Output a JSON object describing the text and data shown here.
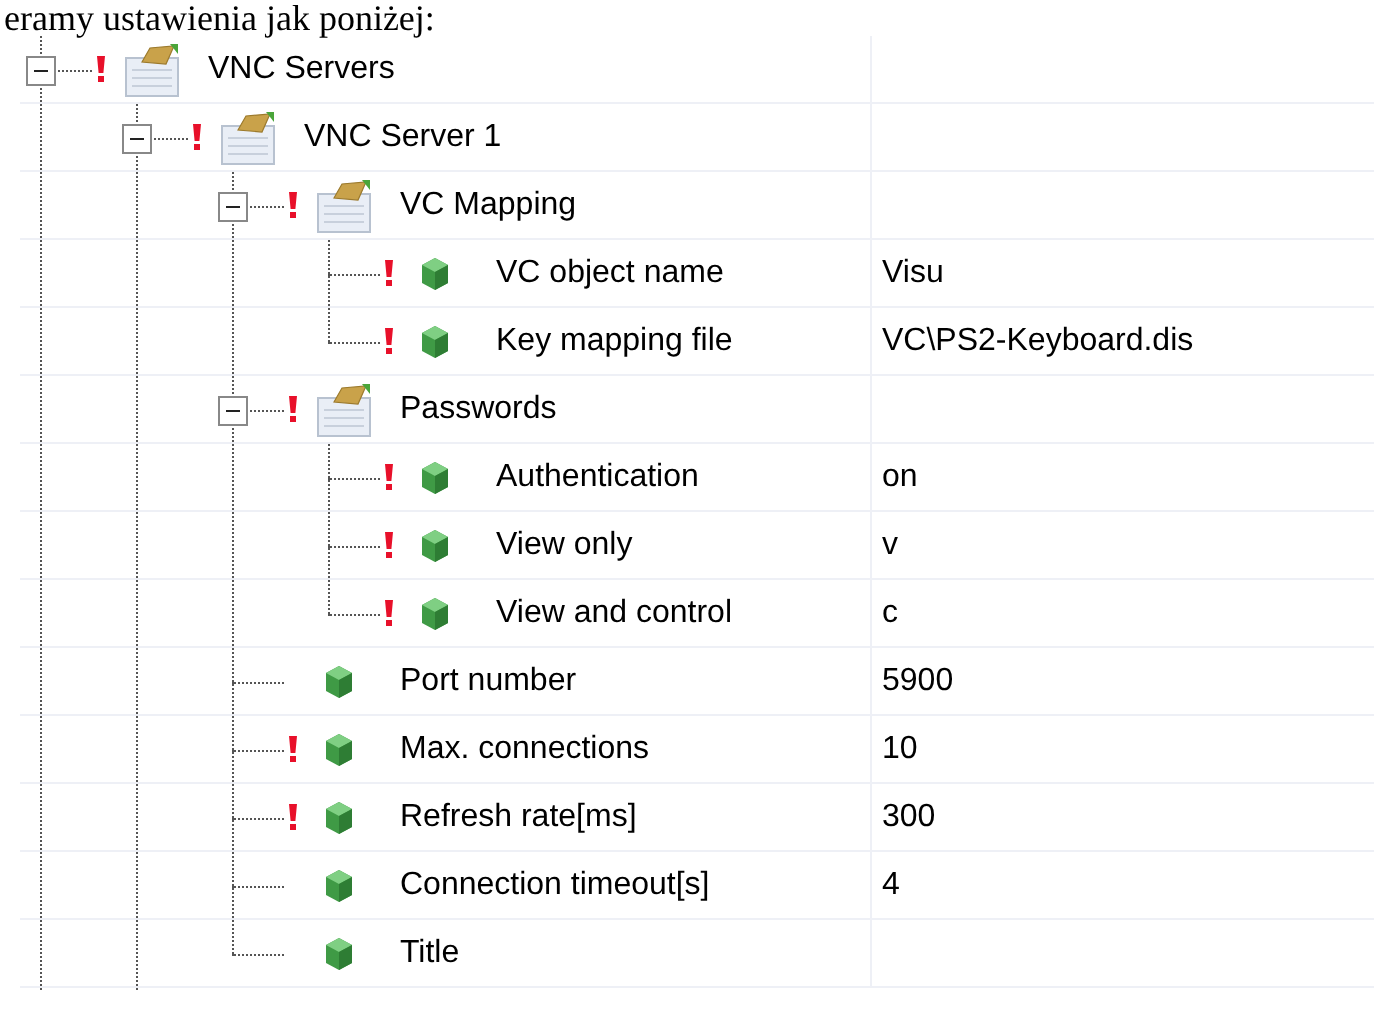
{
  "caption": "eramy ustawienia jak poniżej:",
  "tree": [
    {
      "label": "VNC Servers",
      "kind": "group",
      "warning": true,
      "expanded": true,
      "children": [
        {
          "label": "VNC Server 1",
          "kind": "group",
          "warning": true,
          "expanded": true,
          "children": [
            {
              "label": "VC Mapping",
              "kind": "group",
              "warning": true,
              "expanded": true,
              "children": [
                {
                  "label": "VC object name",
                  "kind": "property",
                  "warning": true,
                  "value": "Visu"
                },
                {
                  "label": "Key mapping file",
                  "kind": "property",
                  "warning": true,
                  "value": "VC\\PS2-Keyboard.dis"
                }
              ]
            },
            {
              "label": "Passwords",
              "kind": "group",
              "warning": true,
              "expanded": true,
              "children": [
                {
                  "label": "Authentication",
                  "kind": "property",
                  "warning": true,
                  "value": "on"
                },
                {
                  "label": "View only",
                  "kind": "property",
                  "warning": true,
                  "value": "v"
                },
                {
                  "label": "View and control",
                  "kind": "property",
                  "warning": true,
                  "value": "c"
                }
              ]
            },
            {
              "label": "Port number",
              "kind": "property",
              "warning": false,
              "value": "5900"
            },
            {
              "label": "Max. connections",
              "kind": "property",
              "warning": true,
              "value": "10"
            },
            {
              "label": "Refresh rate[ms]",
              "kind": "property",
              "warning": true,
              "value": "300"
            },
            {
              "label": "Connection timeout[s]",
              "kind": "property",
              "warning": false,
              "value": "4"
            },
            {
              "label": "Title",
              "kind": "property",
              "warning": false
            }
          ]
        }
      ]
    }
  ]
}
